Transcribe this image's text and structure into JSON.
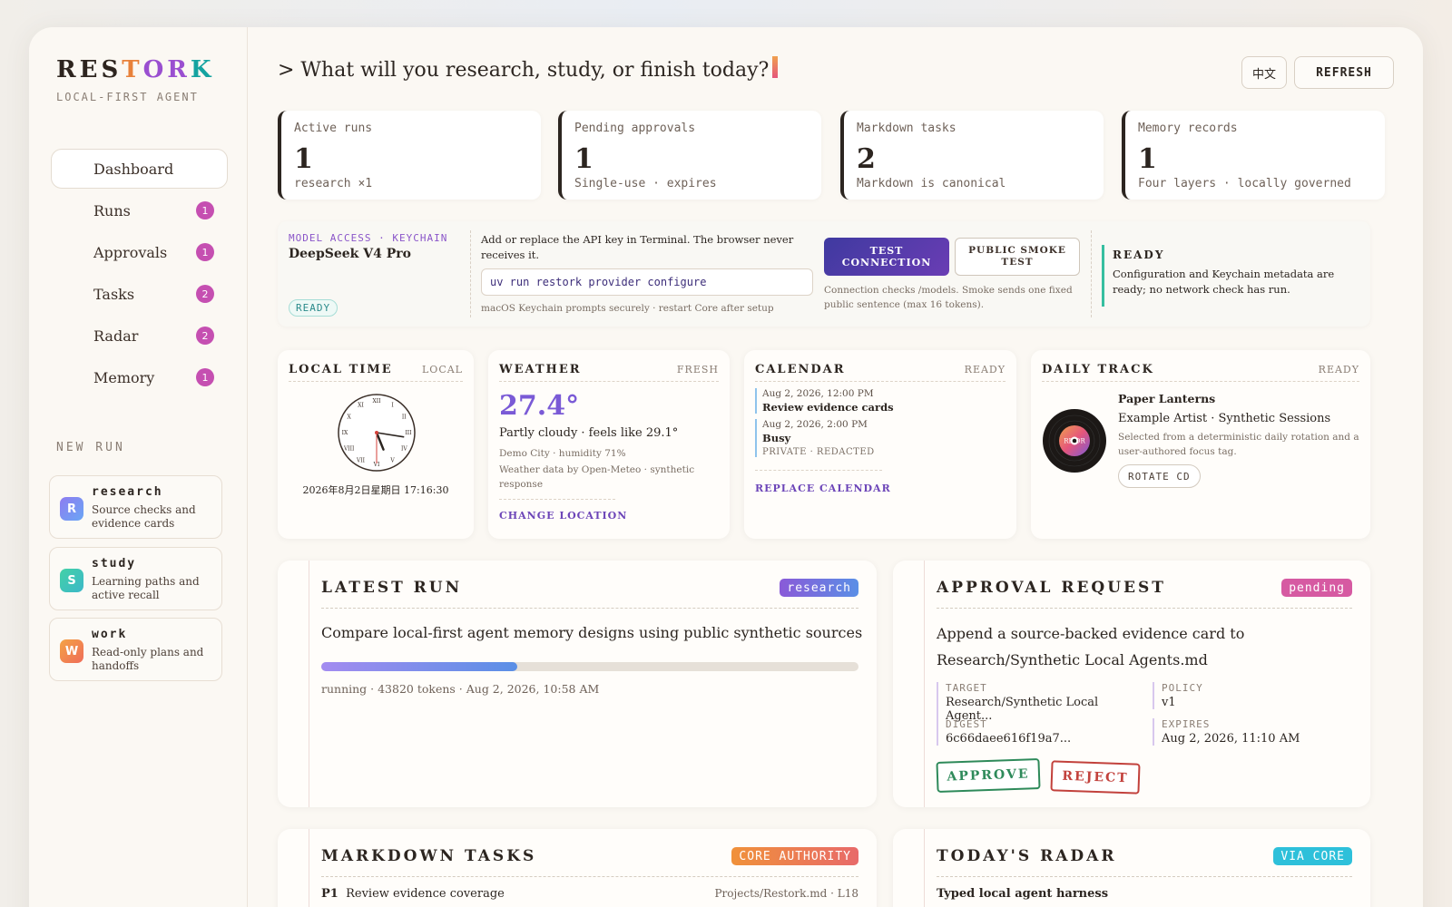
{
  "sidebar": {
    "logo": {
      "r": "R",
      "e": "E",
      "s": "S",
      "t": "T",
      "o": "O",
      "r2": "R",
      "k": "K"
    },
    "tagline": "LOCAL-FIRST AGENT",
    "nav": [
      {
        "label": "Dashboard",
        "count": null
      },
      {
        "label": "Runs",
        "count": "1"
      },
      {
        "label": "Approvals",
        "count": "1"
      },
      {
        "label": "Tasks",
        "count": "2"
      },
      {
        "label": "Radar",
        "count": "2"
      },
      {
        "label": "Memory",
        "count": "1"
      }
    ],
    "new_run_heading": "NEW RUN",
    "run_types": [
      {
        "icon": "R",
        "title": "research",
        "desc": "Source checks and evidence cards",
        "color": "#7b8cf0"
      },
      {
        "icon": "S",
        "title": "study",
        "desc": "Learning paths and active recall",
        "color": "#3dcaa7"
      },
      {
        "icon": "W",
        "title": "work",
        "desc": "Read-only plans and handoffs",
        "color": "#f08a4b"
      }
    ]
  },
  "header": {
    "prompt": "> What will you research, study, or finish today?",
    "lang_button": "中文",
    "refresh_button": "REFRESH"
  },
  "stats": [
    {
      "label": "Active runs",
      "value": "1",
      "sub": "research ×1",
      "color": "#5a8fe6"
    },
    {
      "label": "Pending approvals",
      "value": "1",
      "sub": "Single-use · expires",
      "color": "#d6479f"
    },
    {
      "label": "Markdown tasks",
      "value": "2",
      "sub": "Markdown is canonical",
      "color": "#f0913a"
    },
    {
      "label": "Memory records",
      "value": "1",
      "sub": "Four layers · locally governed",
      "color": "#2fbf9a"
    }
  ],
  "model": {
    "kicker": "MODEL ACCESS · KEYCHAIN",
    "name": "DeepSeek V4 Pro",
    "status": "READY",
    "instructions": "Add or replace the API key in Terminal. The browser never receives it.",
    "command": "uv run restork provider configure",
    "note": "macOS Keychain prompts securely · restart Core after setup",
    "test_button": "TEST CONNECTION",
    "smoke_button": "PUBLIC SMOKE TEST",
    "check_note": "Connection checks /models. Smoke sends one fixed public sentence (max 16 tokens).",
    "ready_title": "READY",
    "ready_text": "Configuration and Keychain metadata are ready; no network check has run."
  },
  "widgets": {
    "time": {
      "title": "LOCAL TIME",
      "status": "LOCAL",
      "datetime": "2026年8月2日星期日 17:16:30",
      "numerals": [
        "XII",
        "I",
        "II",
        "III",
        "IV",
        "V",
        "VI",
        "VII",
        "VIII",
        "IX",
        "X",
        "XI"
      ],
      "clock": {
        "hours": 5,
        "minutes": 16,
        "seconds": 30
      }
    },
    "weather": {
      "title": "WEATHER",
      "status": "FRESH",
      "temp": "27.4°",
      "summary": "Partly cloudy · feels like 29.1°",
      "detail": "Demo City · humidity 71%",
      "source": "Weather data by Open-Meteo · synthetic response",
      "link": "CHANGE LOCATION"
    },
    "calendar": {
      "title": "CALENDAR",
      "status": "READY",
      "events": [
        {
          "time": "Aug 2, 2026, 12:00 PM",
          "name": "Review evidence cards",
          "note": ""
        },
        {
          "time": "Aug 2, 2026, 2:00 PM",
          "name": "Busy",
          "note": "PRIVATE · REDACTED"
        }
      ],
      "link": "REPLACE CALENDAR"
    },
    "track": {
      "title": "DAILY TRACK",
      "status": "READY",
      "song": "Paper Lanterns",
      "artist": "Example Artist · Synthetic Sessions",
      "desc": "Selected from a deterministic daily rotation and a user-authored focus tag.",
      "button": "ROTATE CD",
      "cd_label": "RE OR"
    }
  },
  "latest_run": {
    "title": "LATEST RUN",
    "tag": "research",
    "question": "Compare local-first agent memory designs using public synthetic sources",
    "progress": 0.365,
    "meta": "running · 43820 tokens · Aug 2, 2026, 10:58 AM"
  },
  "approval": {
    "title": "APPROVAL REQUEST",
    "tag": "pending",
    "text": "Append a source-backed evidence card to Research/Synthetic Local Agents.md",
    "target_label": "TARGET",
    "target": "Research/Synthetic Local Agent...",
    "policy_label": "POLICY",
    "policy": "v1",
    "digest_label": "DIGEST",
    "digest": "6c66daee616f19a7...",
    "expires_label": "EXPIRES",
    "expires": "Aug 2, 2026, 11:10 AM",
    "approve": "APPROVE",
    "reject": "REJECT"
  },
  "tasks": {
    "title": "MARKDOWN TASKS",
    "tag": "CORE AUTHORITY",
    "priority": "P1",
    "task": "Review evidence coverage",
    "location": "Projects/Restork.md · L18"
  },
  "radar": {
    "title": "TODAY'S RADAR",
    "tag": "VIA CORE",
    "item": "Typed local agent harness"
  },
  "colors": {
    "accent_purple": "#6c45b8",
    "pink": "#d6479f",
    "nav_badge": "#c54fb1"
  }
}
